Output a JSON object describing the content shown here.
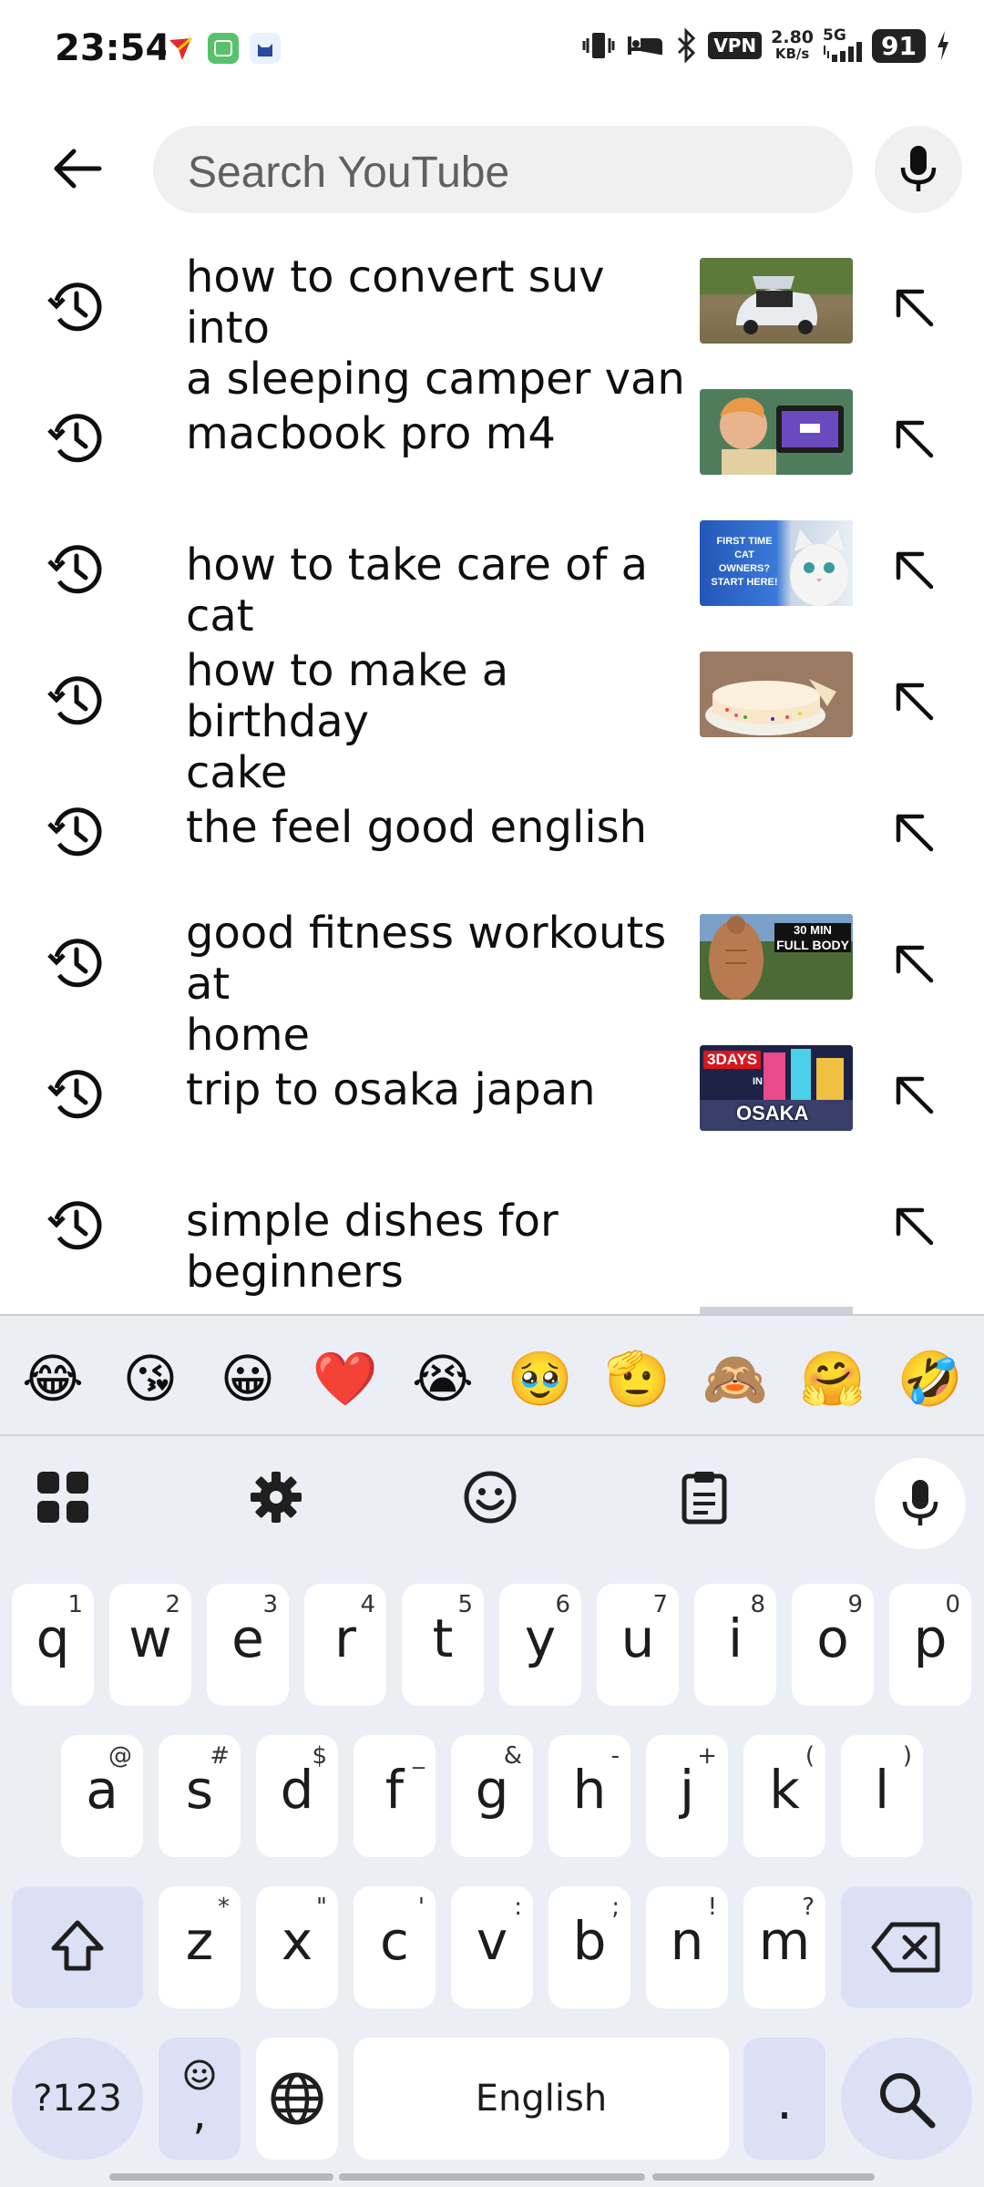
{
  "status_bar": {
    "time": "23:54",
    "vpn": "VPN",
    "speed_value": "2.80",
    "speed_unit": "KB/s",
    "network": "5G",
    "battery": "91"
  },
  "search": {
    "placeholder": "Search YouTube"
  },
  "suggestions": [
    {
      "line1": "how to convert suv into",
      "line2": "a sleeping camper van",
      "thumbnail": "car-trunk-open"
    },
    {
      "line1": "macbook pro m4",
      "line2": "",
      "thumbnail": "person-with-laptop"
    },
    {
      "line1": "how to take care of a cat",
      "line2": "",
      "thumbnail": "white-cat",
      "thumb_text": [
        "FIRST TIME",
        "CAT",
        "OWNERS?",
        "START HERE!"
      ]
    },
    {
      "line1": "how to make a birthday",
      "line2": "cake",
      "thumbnail": "sprinkle-cake"
    },
    {
      "line1": "the feel good english",
      "line2": "",
      "thumbnail": null
    },
    {
      "line1": "good fitness workouts at",
      "line2": "home",
      "thumbnail": "fitness-man",
      "thumb_text": [
        "30 MIN",
        "FULL BODY"
      ]
    },
    {
      "line1": "trip to osaka japan",
      "line2": "",
      "thumbnail": "osaka-city",
      "thumb_text": [
        "3DAYS",
        "IN",
        "OSAKA"
      ]
    },
    {
      "line1": "simple dishes for beginners",
      "line2": "",
      "thumbnail": null
    }
  ],
  "keyboard": {
    "emojis": [
      "😂",
      "😘",
      "😀",
      "❤️",
      "😭",
      "🥹",
      "🫡",
      "🙈",
      "🤗",
      "🤣"
    ],
    "row1": [
      {
        "k": "q",
        "s": "1"
      },
      {
        "k": "w",
        "s": "2"
      },
      {
        "k": "e",
        "s": "3"
      },
      {
        "k": "r",
        "s": "4"
      },
      {
        "k": "t",
        "s": "5"
      },
      {
        "k": "y",
        "s": "6"
      },
      {
        "k": "u",
        "s": "7"
      },
      {
        "k": "i",
        "s": "8"
      },
      {
        "k": "o",
        "s": "9"
      },
      {
        "k": "p",
        "s": "0"
      }
    ],
    "row2": [
      {
        "k": "a",
        "s": "@"
      },
      {
        "k": "s",
        "s": "#"
      },
      {
        "k": "d",
        "s": "$"
      },
      {
        "k": "f",
        "s": "_"
      },
      {
        "k": "g",
        "s": "&"
      },
      {
        "k": "h",
        "s": "-"
      },
      {
        "k": "j",
        "s": "+"
      },
      {
        "k": "k",
        "s": "("
      },
      {
        "k": "l",
        "s": ")"
      }
    ],
    "row3": [
      {
        "k": "z",
        "s": "*"
      },
      {
        "k": "x",
        "s": "\""
      },
      {
        "k": "c",
        "s": "'"
      },
      {
        "k": "v",
        "s": ":"
      },
      {
        "k": "b",
        "s": ";"
      },
      {
        "k": "n",
        "s": "!"
      },
      {
        "k": "m",
        "s": "?"
      }
    ],
    "symbols_label": "?123",
    "comma_label": ",",
    "space_label": "English",
    "period_label": "."
  }
}
